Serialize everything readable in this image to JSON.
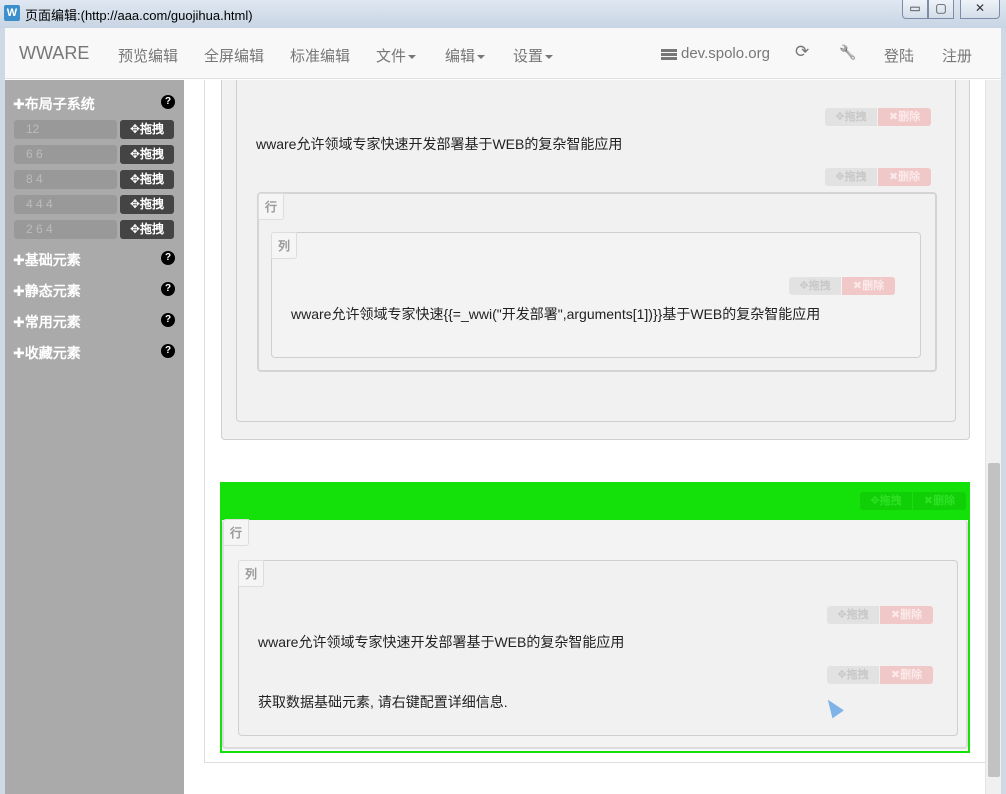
{
  "window": {
    "title": "页面编辑:(http://aaa.com/guojihua.html)",
    "app_icon": "W",
    "minimize": "▭",
    "maximize": "▢",
    "close": "✕"
  },
  "navbar": {
    "brand": "WWARE",
    "items": [
      "预览编辑",
      "全屏编辑",
      "标准编辑"
    ],
    "menus": [
      "文件",
      "编辑",
      "设置"
    ],
    "server": "dev.spolo.org",
    "refresh_icon": "⟳",
    "wrench_icon": "🔧",
    "login": "登陆",
    "register": "注册"
  },
  "sidebar": {
    "sections": [
      {
        "label": "✚布局子系统",
        "help": "?"
      },
      {
        "label": "✚基础元素",
        "help": "?"
      },
      {
        "label": "✚静态元素",
        "help": "?"
      },
      {
        "label": "✚常用元素",
        "help": "?"
      },
      {
        "label": "✚收藏元素",
        "help": "?"
      }
    ],
    "layouts": [
      {
        "cell": "12",
        "drag": "✥拖拽"
      },
      {
        "cell": "6 6",
        "drag": "✥拖拽"
      },
      {
        "cell": "8 4",
        "drag": "✥拖拽"
      },
      {
        "cell": "4 4 4",
        "drag": "✥拖拽"
      },
      {
        "cell": "2 6 4",
        "drag": "✥拖拽"
      }
    ]
  },
  "canvas": {
    "ctl_drag": "✥拖拽",
    "ctl_delete": "✖删除",
    "row_label": "行",
    "col_label": "列",
    "text_1": "wware允许领域专家快速开发部署基于WEB的复杂智能应用",
    "text_2": "wware允许领域专家快速{{=_wwi(\"开发部署\",arguments[1])}}基于WEB的复杂智能应用",
    "text_3": "wware允许领域专家快速开发部署基于WEB的复杂智能应用",
    "text_4": "获取数据基础元素, 请右键配置详细信息."
  },
  "colors": {
    "sidebar_bg": "#aaaaaa",
    "selected_green": "#14e00a",
    "delete_red": "#f0c8c8"
  }
}
